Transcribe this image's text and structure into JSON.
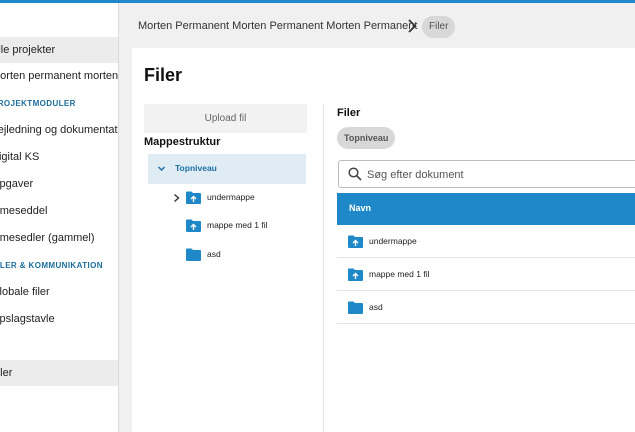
{
  "sidebar": {
    "items": [
      {
        "label": "Alle projekter"
      },
      {
        "label": "Morten permanent morten permanent"
      },
      {
        "label": "Vejledning og dokumentation"
      },
      {
        "label": "Digital KS"
      },
      {
        "label": "Opgaver"
      },
      {
        "label": "Timeseddel"
      },
      {
        "label": "Timesedler (gammel)"
      },
      {
        "label": "Globale filer"
      },
      {
        "label": "Opslagstavle"
      },
      {
        "label": "Filer"
      }
    ],
    "sections": [
      {
        "label": "PROJEKTMODULER"
      },
      {
        "label": "FILER & KOMMUNIKATION"
      }
    ]
  },
  "breadcrumb": {
    "path": "Morten Permanent Morten Permanent Morten Permanent",
    "current": "Filer"
  },
  "main": {
    "title": "Filer",
    "upload_label": "Upload fil",
    "tree": {
      "heading": "Mappestruktur",
      "root_label": "Topniveau",
      "nodes": [
        {
          "label": "undermappe",
          "icon": "folder-upload-icon"
        },
        {
          "label": "mappe med 1 fil",
          "icon": "folder-upload-icon"
        },
        {
          "label": "asd",
          "icon": "folder-icon"
        }
      ]
    },
    "files": {
      "heading": "Filer",
      "level_chip": "Topniveau",
      "search_placeholder": "Søg efter dokument",
      "column_name": "Navn",
      "rows": [
        {
          "label": "undermappe",
          "icon": "folder-upload-icon"
        },
        {
          "label": "mappe med 1 fil",
          "icon": "folder-upload-icon"
        },
        {
          "label": "asd",
          "icon": "folder-icon"
        }
      ]
    }
  },
  "colors": {
    "accent": "#1e88c9",
    "selected_bg": "#e0ecf4",
    "section_label": "#1a6e9c"
  }
}
